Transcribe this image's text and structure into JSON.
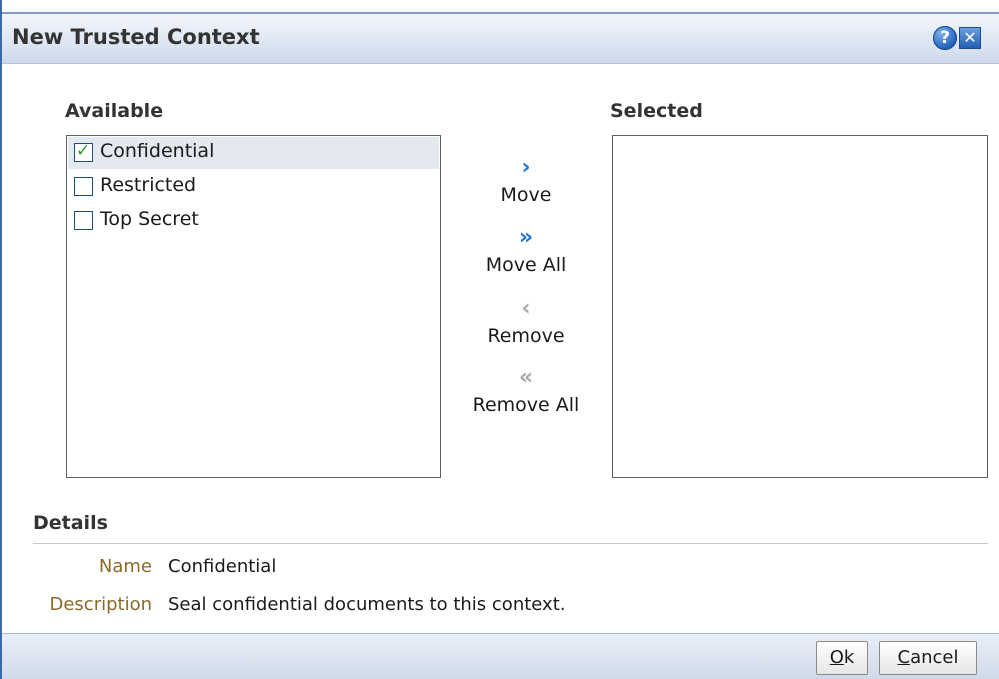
{
  "dialog": {
    "title": "New Trusted Context",
    "help_icon": "help-icon",
    "close_icon": "close-icon"
  },
  "available": {
    "label": "Available",
    "items": [
      {
        "label": "Confidential",
        "checked": true
      },
      {
        "label": "Restricted",
        "checked": false
      },
      {
        "label": "Top Secret",
        "checked": false
      }
    ]
  },
  "selected": {
    "label": "Selected",
    "items": []
  },
  "shuttle": {
    "move": {
      "label": "Move",
      "glyph": "›",
      "icon": "move-icon"
    },
    "move_all": {
      "label": "Move All",
      "glyph": "»",
      "icon": "move-all-icon"
    },
    "remove": {
      "label": "Remove",
      "glyph": "‹",
      "icon": "remove-icon"
    },
    "remove_all": {
      "label": "Remove All",
      "glyph": "«",
      "icon": "remove-all-icon"
    }
  },
  "details": {
    "heading": "Details",
    "name_label": "Name",
    "name_value": "Confidential",
    "description_label": "Description",
    "description_value": "Seal confidential documents to this context."
  },
  "footer": {
    "ok_label": "Ok",
    "ok_rest": "k",
    "ok_mnemonic": "O",
    "cancel_label": "Cancel",
    "cancel_rest": "ancel",
    "cancel_mnemonic": "C"
  },
  "colors": {
    "accent_blue": "#1d72d6",
    "check_green": "#2e9a29",
    "detail_label": "#8a6a2a"
  }
}
